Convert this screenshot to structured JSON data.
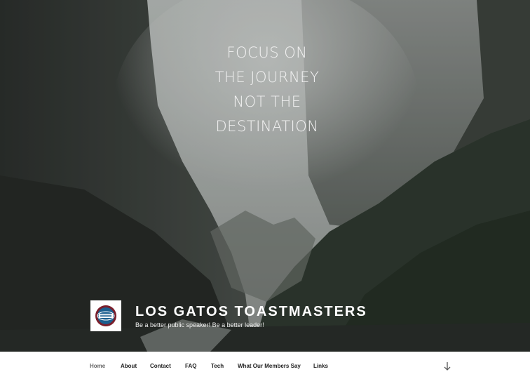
{
  "hero": {
    "quote_lines": [
      "FOCUS ON",
      "THE JOURNEY",
      "NOT THE",
      "DESTINATION"
    ]
  },
  "site": {
    "logo": "toastmasters-logo",
    "title": "LOS GATOS TOASTMASTERS",
    "tagline": "Be a better public speaker! Be a better leader!"
  },
  "nav": {
    "items": [
      {
        "label": "Home",
        "active": true
      },
      {
        "label": "About"
      },
      {
        "label": "Contact"
      },
      {
        "label": "FAQ"
      },
      {
        "label": "Tech"
      },
      {
        "label": "What Our Members Say"
      },
      {
        "label": "Links"
      }
    ],
    "scroll_icon": "arrow-down-icon"
  }
}
